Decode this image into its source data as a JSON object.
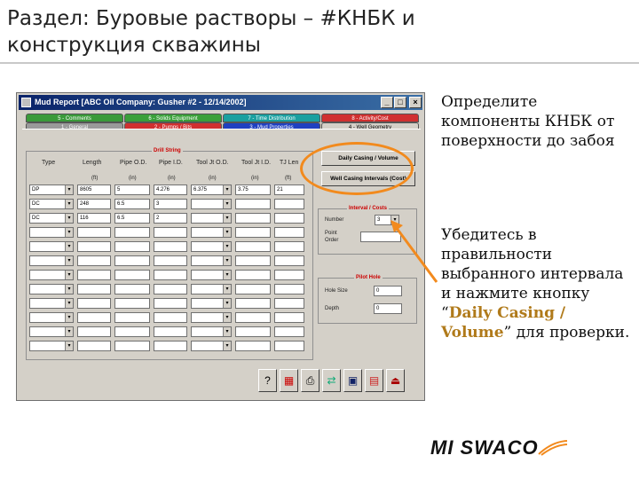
{
  "slide": {
    "title": "Раздел: Буровые растворы – #КНБК и конструкция скважины",
    "para1": "Определите компоненты КНБК от поверхности до забоя",
    "para2_prefix": "Убедитесь в правильности выбранного интервала и нажмите кнопку “",
    "para2_highlight": "Daily Casing / Volume",
    "para2_suffix": "” для проверки.",
    "logo_text": "MI SWACO"
  },
  "window": {
    "title": "Mud Report [ABC Oil Company: Gusher #2 - 12/14/2002]",
    "tabs_top": [
      "5 - Comments",
      "6 - Solids Equipment",
      "7 - Time Distribution",
      "8 - Activity/Cost"
    ],
    "tabs_bottom": [
      "1 - General",
      "2 - Pumps / Bits",
      "3 - Mud Properties",
      "4 - Well Geometry"
    ],
    "group_title": "Drill String",
    "columns": [
      "Type",
      "Length",
      "Pipe O.D.",
      "Pipe I.D.",
      "Tool Jt O.D.",
      "Tool Jt I.D.",
      "TJ Len"
    ],
    "units": [
      "",
      "(ft)",
      "(in)",
      "(in)",
      "(in)",
      "(in)",
      "(ft)"
    ],
    "rows": [
      [
        "DP",
        "8605",
        "5",
        "4.276",
        "6.375",
        "3.75",
        "21"
      ],
      [
        "DC",
        "248",
        "6.5",
        "3",
        "",
        "",
        ""
      ],
      [
        "DC",
        "116",
        "6.5",
        "2",
        "",
        "",
        ""
      ]
    ],
    "buttons": {
      "daily_casing": "Daily Casing / Volume",
      "well_casing": "Well Casing Intervals (Cost)"
    },
    "interval_group": {
      "title": "Interval / Costs",
      "number_label": "Number",
      "number_value": "3",
      "point_order_label": "Point Order"
    },
    "pilot_group": {
      "title": "Pilot Hole",
      "hole_size_label": "Hole Size",
      "hole_size_value": "0",
      "depth_label": "Depth",
      "depth_value": "0"
    },
    "controls": {
      "min": "_",
      "max": "□",
      "close": "×"
    },
    "toolbar_icons": [
      "help-icon",
      "chart-icon",
      "print-icon",
      "export-icon",
      "save-icon",
      "calculator-icon",
      "exit-icon"
    ],
    "toolbar_glyphs": [
      "?",
      "▦",
      "⎙",
      "⇄",
      "▣",
      "▤",
      "⏏"
    ]
  },
  "colors": {
    "accent_orange": "#f28a1d",
    "button_text_gold": "#b07a1a",
    "window_grey": "#d4d0c8"
  }
}
